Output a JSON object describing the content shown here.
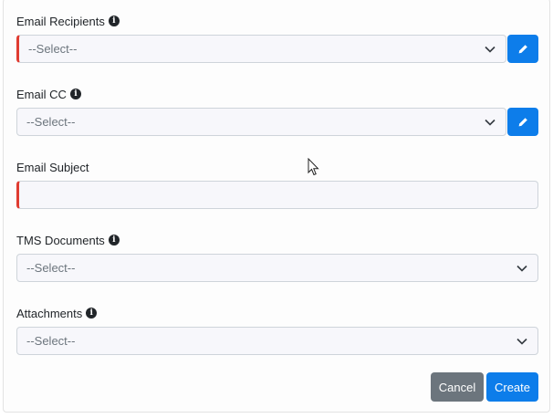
{
  "form": {
    "email_recipients": {
      "label": "Email Recipients",
      "placeholder": "--Select--"
    },
    "email_cc": {
      "label": "Email CC",
      "placeholder": "--Select--"
    },
    "email_subject": {
      "label": "Email Subject",
      "value": ""
    },
    "tms_documents": {
      "label": "TMS Documents",
      "placeholder": "--Select--"
    },
    "attachments": {
      "label": "Attachments",
      "placeholder": "--Select--"
    }
  },
  "actions": {
    "cancel_label": "Cancel",
    "create_label": "Create"
  },
  "colors": {
    "primary": "#0d7dea",
    "secondary": "#6c757d",
    "required": "#e03c31"
  },
  "icons": [
    "info-icon",
    "chevron-down-icon",
    "pencil-icon",
    "mouse-cursor-icon"
  ]
}
